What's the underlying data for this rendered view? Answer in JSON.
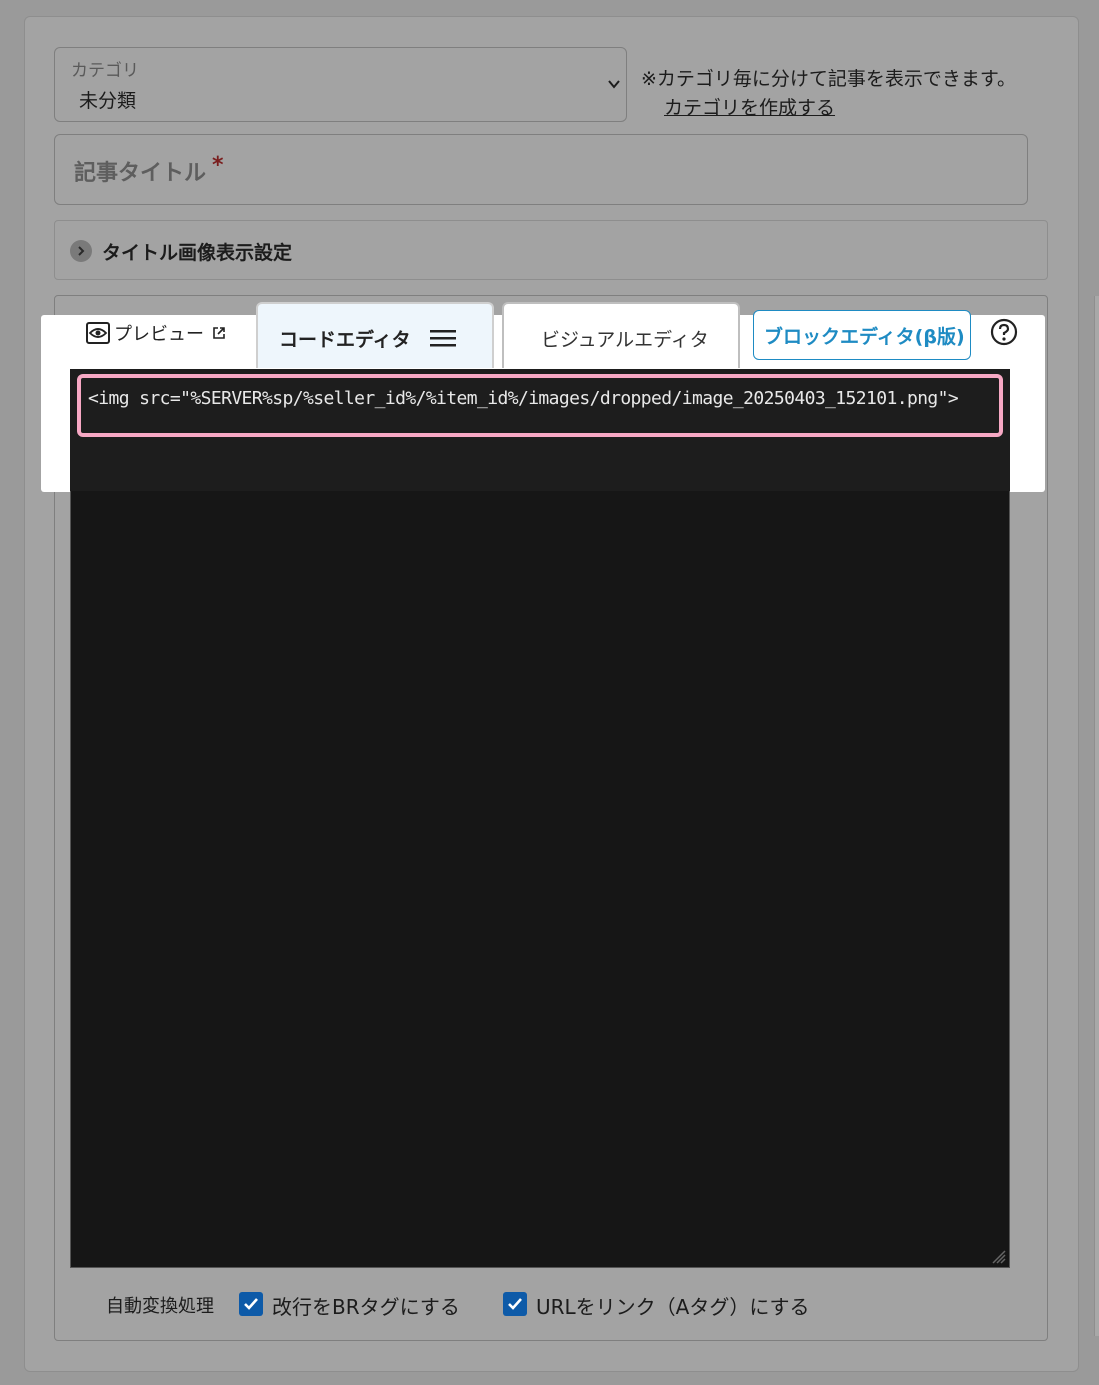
{
  "category": {
    "label": "カテゴリ",
    "value": "未分類",
    "note": "※カテゴリ毎に分けて記事を表示できます。",
    "create_link": "カテゴリを作成する"
  },
  "title_input": {
    "placeholder": "記事タイトル",
    "required_mark": "*"
  },
  "title_image_settings": {
    "label": "タイトル画像表示設定"
  },
  "tabs": {
    "preview": "プレビュー",
    "code_editor": "コードエディタ",
    "visual_editor": "ビジュアルエディタ",
    "block_editor": "ブロックエディタ(β版)"
  },
  "code": {
    "first_line": "<img src=\"%SERVER%sp/%seller_id%/%item_id%/images/dropped/image_20250403_152101.png\">"
  },
  "auto_convert": {
    "label": "自動変換処理",
    "options": [
      {
        "label": "改行をBRタグにする",
        "checked": true
      },
      {
        "label": "URLをリンク（Aタグ）にする",
        "checked": true
      }
    ]
  },
  "colors": {
    "accent": "#1e8bc3",
    "highlight_border": "#f7a8c4",
    "checkbox": "#0d5aa8"
  }
}
